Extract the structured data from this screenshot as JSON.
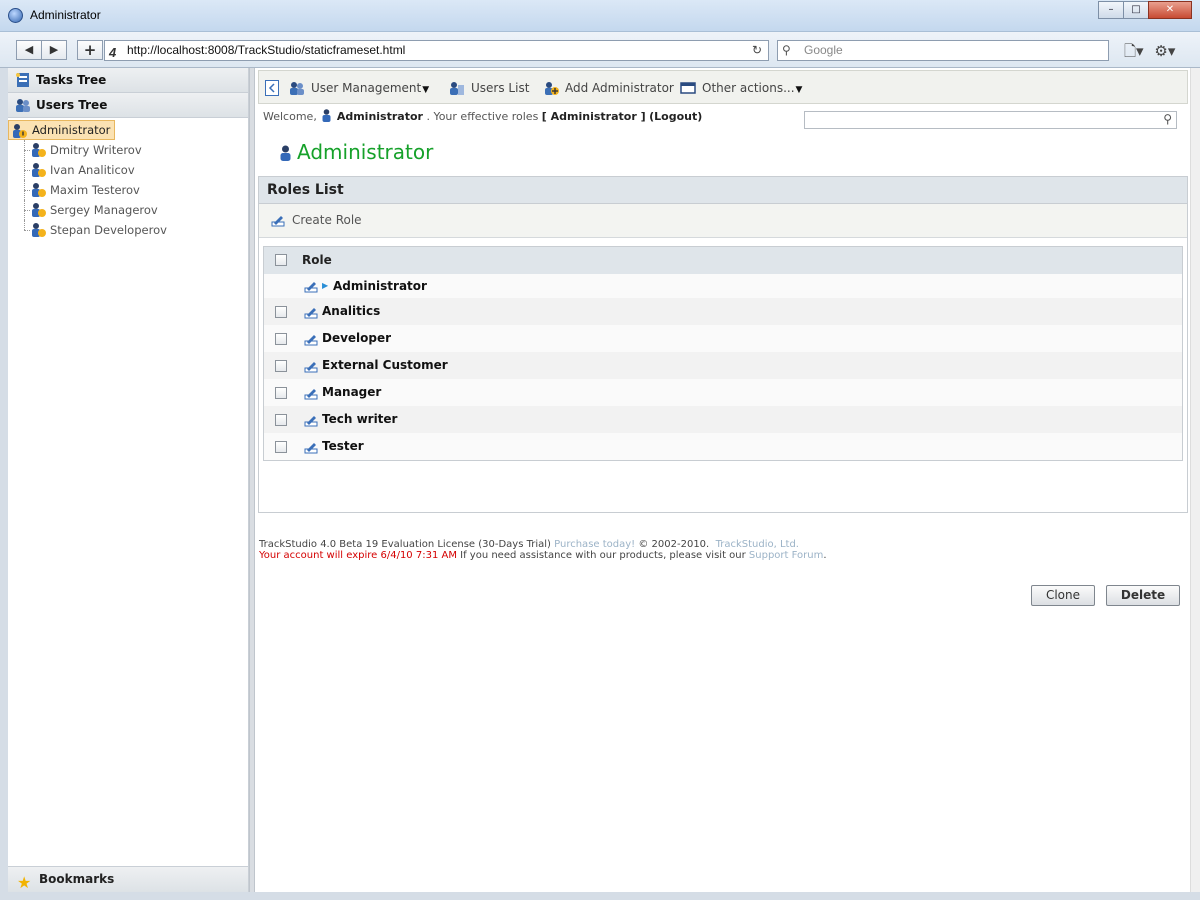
{
  "window": {
    "title": "Administrator",
    "min": "–",
    "max": "□",
    "close": "✕"
  },
  "browser": {
    "back": "◀",
    "forward": "▶",
    "add": "+",
    "url": "http://localhost:8008/TrackStudio/staticframeset.html",
    "search_placeholder": "Google",
    "reload": "C"
  },
  "sidebar": {
    "tasks_tree": "Tasks Tree",
    "users_tree": "Users Tree",
    "root": "Administrator",
    "children": [
      "Dmitry Writerov",
      "Ivan Analiticov",
      "Maxim Testerov",
      "Sergey Managerov",
      "Stepan Developerov"
    ],
    "bookmarks": "Bookmarks"
  },
  "toolbar": {
    "user_management": "User Management",
    "users_list": "Users List",
    "add_administrator": "Add Administrator",
    "other_actions": "Other actions..."
  },
  "welcome": {
    "prefix": "Welcome,",
    "user": "Administrator",
    "roles_text": ". Your effective roles",
    "role_value": "[ Administrator ]",
    "logout": "(Logout)"
  },
  "page": {
    "title": "Administrator"
  },
  "roles": {
    "panel_title": "Roles List",
    "create_role": "Create Role",
    "column_role": "Role",
    "items": [
      "Administrator",
      "Analitics",
      "Developer",
      "External Customer",
      "Manager",
      "Tech writer",
      "Tester"
    ]
  },
  "buttons": {
    "clone": "Clone",
    "delete": "Delete"
  },
  "footer": {
    "license": "TrackStudio 4.0 Beta 19 Evaluation License (30-Days Trial)",
    "purchase": "Purchase today!",
    "copyright": "© 2002-2010.",
    "company": "TrackStudio, Ltd.",
    "expire": "Your account will expire 6/4/10 7:31 AM",
    "assist": "If you need assistance with our products, please visit our",
    "forum": "Support Forum",
    "period": "."
  }
}
